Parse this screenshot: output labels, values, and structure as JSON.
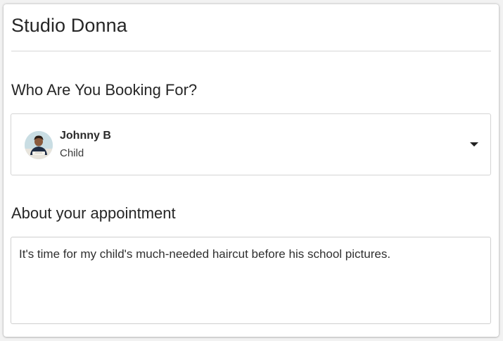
{
  "header": {
    "studio_name": "Studio Donna"
  },
  "booking": {
    "heading": "Who Are You Booking For?",
    "selected_client": {
      "name": "Johnny B",
      "relation": "Child",
      "avatar_icon": "child-photo-avatar"
    },
    "dropdown_icon": "caret-down-icon"
  },
  "appointment": {
    "heading": "About your appointment",
    "notes_value": "It's time for my child's much-needed haircut before his school pictures."
  },
  "colors": {
    "background": "#f2f2f2",
    "card": "#ffffff",
    "border": "#d4d4d4",
    "text": "#262626"
  }
}
